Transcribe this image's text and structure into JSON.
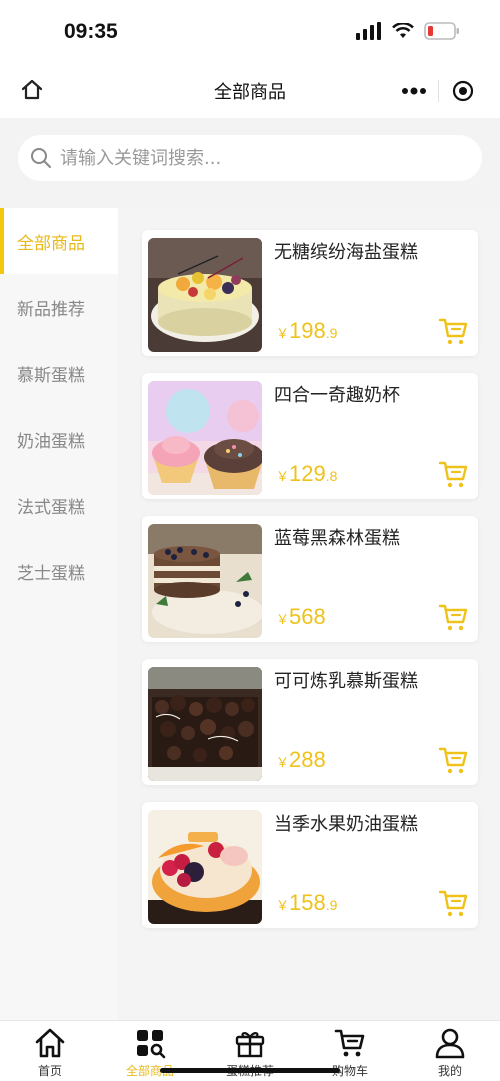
{
  "status_bar": {
    "time": "09:35"
  },
  "nav": {
    "title": "全部商品"
  },
  "search": {
    "placeholder": "请输入关键词搜索..."
  },
  "sidebar": {
    "items": [
      {
        "label": "全部商品",
        "active": true
      },
      {
        "label": "新品推荐",
        "active": false
      },
      {
        "label": "慕斯蛋糕",
        "active": false
      },
      {
        "label": "奶油蛋糕",
        "active": false
      },
      {
        "label": "法式蛋糕",
        "active": false
      },
      {
        "label": "芝士蛋糕",
        "active": false
      }
    ]
  },
  "products": [
    {
      "name": "无糖缤纷海盐蛋糕",
      "currency": "￥",
      "price_int": "198",
      "price_dec": ".9"
    },
    {
      "name": "四合一奇趣奶杯",
      "currency": "￥",
      "price_int": "129",
      "price_dec": ".8"
    },
    {
      "name": "蓝莓黑森林蛋糕",
      "currency": "￥",
      "price_int": "568",
      "price_dec": ""
    },
    {
      "name": "可可炼乳慕斯蛋糕",
      "currency": "￥",
      "price_int": "288",
      "price_dec": ""
    },
    {
      "name": "当季水果奶油蛋糕",
      "currency": "￥",
      "price_int": "158",
      "price_dec": ".9"
    }
  ],
  "tabs": [
    {
      "label": "首页",
      "icon": "home-icon",
      "active": false
    },
    {
      "label": "全部商品",
      "icon": "grid-search-icon",
      "active": true
    },
    {
      "label": "蛋糕推荐",
      "icon": "gift-icon",
      "active": false
    },
    {
      "label": "购物车",
      "icon": "cart-icon",
      "active": false
    },
    {
      "label": "我的",
      "icon": "user-icon",
      "active": false
    }
  ],
  "colors": {
    "accent": "#efc21a",
    "active_text": "#e8b91a"
  }
}
